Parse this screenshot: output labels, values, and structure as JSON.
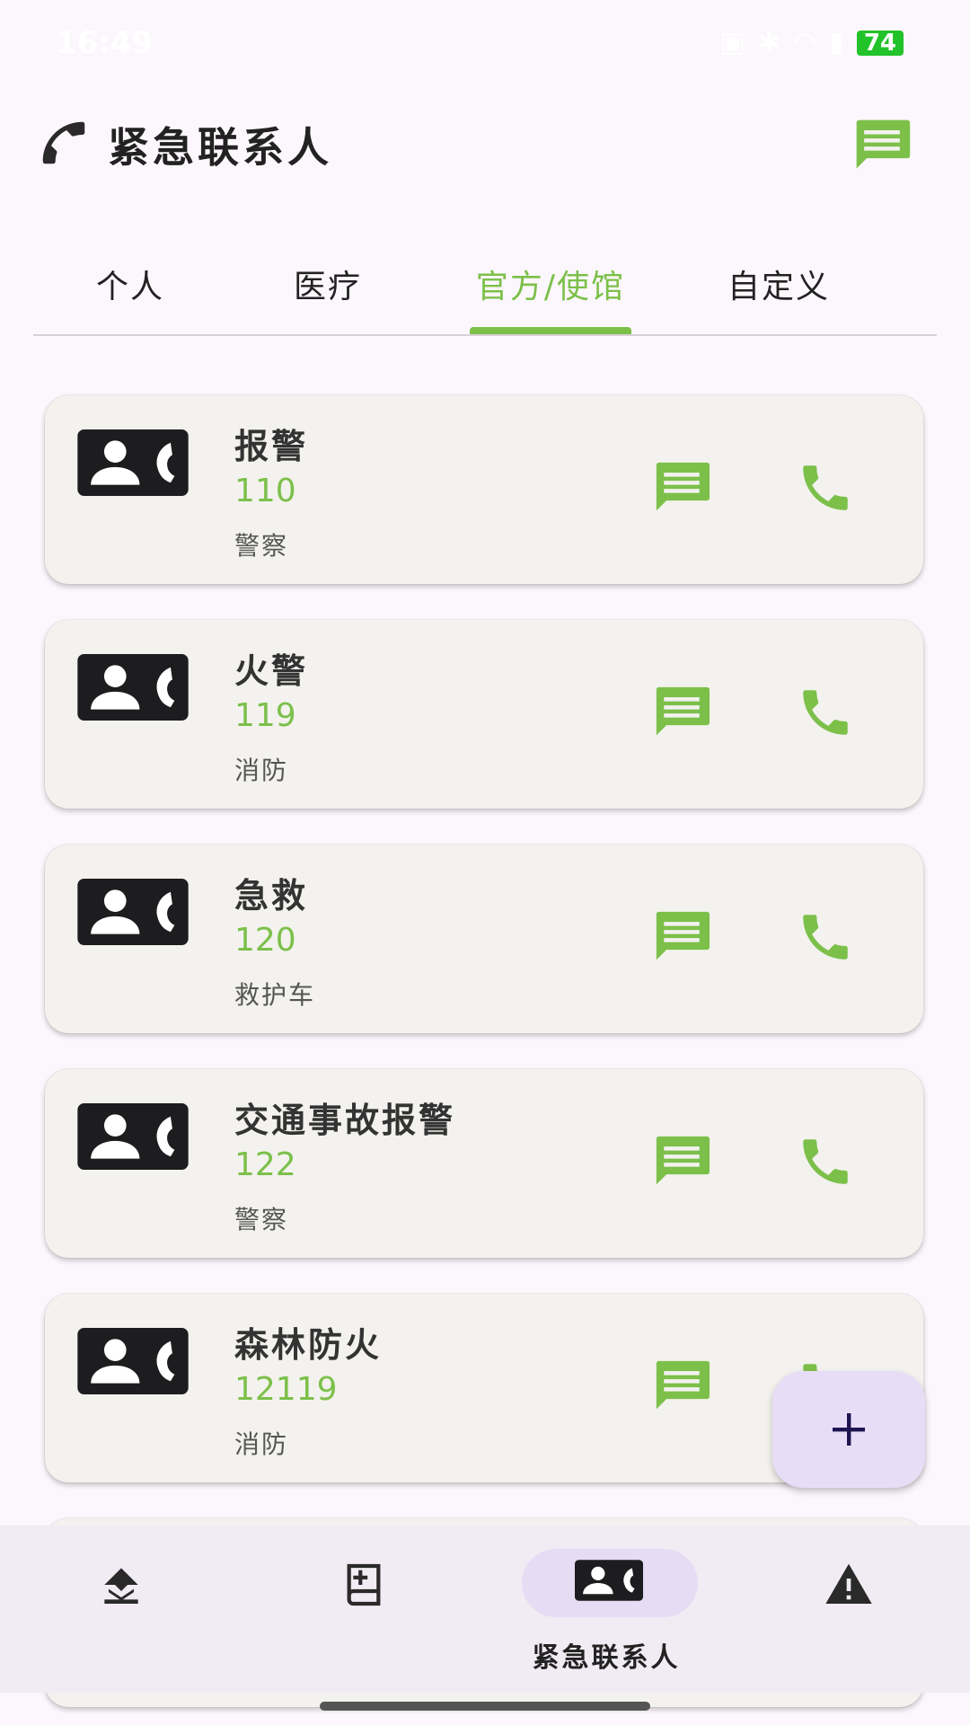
{
  "status_bar": {
    "time": "16:49",
    "battery": "74"
  },
  "app_bar": {
    "title": "紧急联系人"
  },
  "tabs": [
    {
      "label": "个人",
      "active": false
    },
    {
      "label": "医疗",
      "active": false
    },
    {
      "label": "官方/使馆",
      "active": true
    },
    {
      "label": "自定义",
      "active": false
    }
  ],
  "contacts": [
    {
      "name": "报警",
      "number": "110",
      "desc": "警察"
    },
    {
      "name": "火警",
      "number": "119",
      "desc": "消防"
    },
    {
      "name": "急救",
      "number": "120",
      "desc": "救护车"
    },
    {
      "name": "交通事故报警",
      "number": "122",
      "desc": "警察"
    },
    {
      "name": "森林防火",
      "number": "12119",
      "desc": "消防"
    }
  ],
  "fab": {
    "icon": "plus-icon"
  },
  "bottom_nav": {
    "items": [
      {
        "icon": "upload-icon",
        "label": ""
      },
      {
        "icon": "medical-book-icon",
        "label": ""
      },
      {
        "icon": "contact-card-icon",
        "label": "紧急联系人",
        "active": true
      },
      {
        "icon": "warning-icon",
        "label": ""
      }
    ]
  },
  "colors": {
    "accent_green": "#7cc04a",
    "background": "#fcf7fc",
    "card": "#f3f2ee",
    "fab": "#e8ddf7",
    "nav_pill": "#e6dcf4"
  }
}
